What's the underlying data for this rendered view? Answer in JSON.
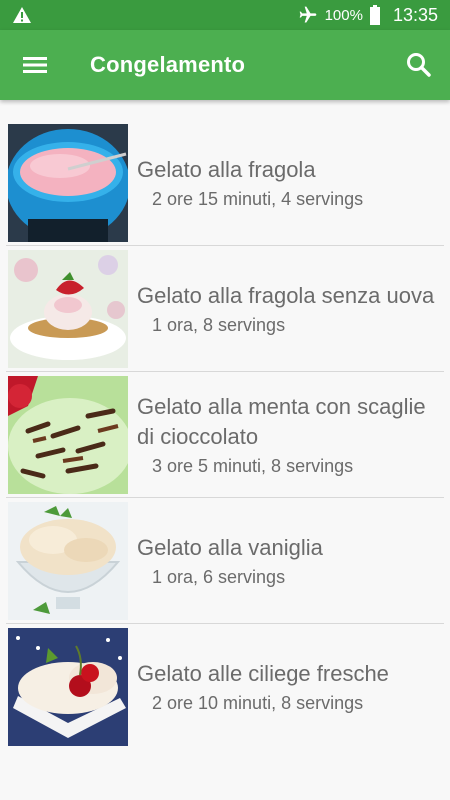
{
  "status_bar": {
    "battery": "100%",
    "time": "13:35",
    "icons": [
      "warning-icon",
      "airplane-icon",
      "battery-icon"
    ]
  },
  "app_bar": {
    "title": "Congelamento",
    "menu_icon": "menu-icon",
    "search_icon": "search-icon",
    "color": "#4caf50",
    "status_color": "#3a9b3f"
  },
  "recipes": [
    {
      "title": "Gelato alla fragola",
      "details": "2 ore 15 minuti, 4 servings",
      "image": "strawberry-ice-cream-bowl"
    },
    {
      "title": "Gelato alla fragola senza uova",
      "details": "1 ora, 8 servings",
      "image": "strawberry-ice-cream-plate"
    },
    {
      "title": "Gelato alla menta con scaglie di cioccolato",
      "details": "3 ore 5 minuti, 8 servings",
      "image": "mint-chocolate-chip-ice-cream"
    },
    {
      "title": "Gelato alla vaniglia",
      "details": "1 ora, 6 servings",
      "image": "vanilla-ice-cream-glass"
    },
    {
      "title": "Gelato alle ciliege fresche",
      "details": "2 ore 10 minuti, 8 servings",
      "image": "cherry-ice-cream-bowl"
    }
  ]
}
